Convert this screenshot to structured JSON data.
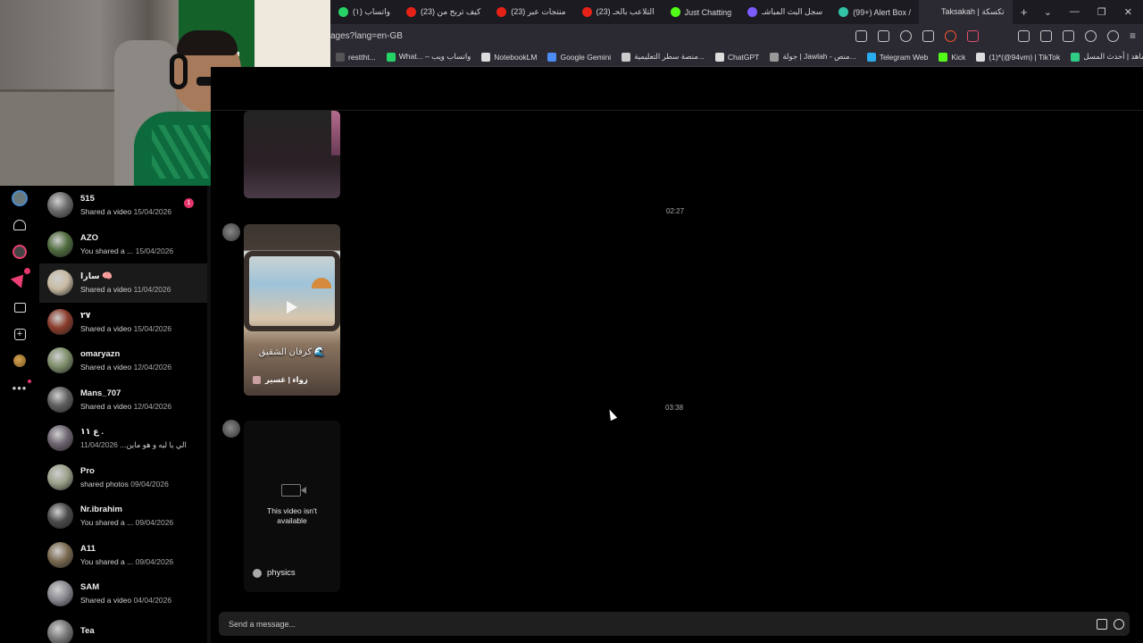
{
  "browser": {
    "tabs": [
      {
        "label": "(١) واتساب",
        "color": "#25d366"
      },
      {
        "label": "(23) كيف تربح من",
        "color": "#e62117"
      },
      {
        "label": "(23) منتجات عبر",
        "color": "#e62117"
      },
      {
        "label": "(23) التلاعب بالحـ",
        "color": "#e62117"
      },
      {
        "label": "Just Chatting",
        "color": "#53fc18"
      },
      {
        "label": "سجل البث المباشـ",
        "color": "#7b5cff"
      },
      {
        "label": "(99+) Alert Box /",
        "color": "#32c3a6"
      },
      {
        "label": "Taksakah | تكسكة",
        "color": "#2b2a33"
      }
    ],
    "url": "ages?lang=en-GB",
    "bookmarks": [
      {
        "label": "resttht...",
        "color": "#555"
      },
      {
        "label": "What... – واتساب ويب",
        "color": "#25d366"
      },
      {
        "label": "NotebookLM",
        "color": "#dddddd"
      },
      {
        "label": "Google Gemini",
        "color": "#4e8cf5"
      },
      {
        "label": "منصة سطر التعليمية...",
        "color": "#cccccc"
      },
      {
        "label": "ChatGPT",
        "color": "#dddddd"
      },
      {
        "label": "جولة | Jawlah - منص...",
        "color": "#999999"
      },
      {
        "label": "Telegram Web",
        "color": "#2aabee"
      },
      {
        "label": "Kick",
        "color": "#53fc18"
      },
      {
        "label": "(1)*(@94vm) | TikTok",
        "color": "#dddddd"
      },
      {
        "label": "شاهد | أحدث المسل...",
        "color": "#2fcc85"
      }
    ]
  },
  "conversations": [
    {
      "name": "515",
      "sub": "Shared a video",
      "date": "15/04/2026",
      "unread": "1",
      "avatar": "#6a6a6a"
    },
    {
      "name": "AZO",
      "sub": "You shared a ...",
      "date": "15/04/2026",
      "avatar": "#4f6b3e"
    },
    {
      "name": "سارا 🧠",
      "sub": "Shared a video",
      "date": "11/04/2026",
      "avatar": "#c9bba3",
      "highlight": true
    },
    {
      "name": "٢٧",
      "sub": "Shared a video",
      "date": "15/04/2026",
      "avatar": "#8a3b2a"
    },
    {
      "name": "omaryazn",
      "sub": "Shared a video",
      "date": "12/04/2026",
      "avatar": "#7e8e6a"
    },
    {
      "name": "Mans_707",
      "sub": "Shared a video",
      "date": "12/04/2026",
      "avatar": "#5f5f5f"
    },
    {
      "name": "ع ١١ .",
      "sub": "الي يا ليه و هو ماين...",
      "date": "11/04/2026",
      "avatar": "#6d6570"
    },
    {
      "name": "Pro",
      "sub": "shared photos",
      "date": "09/04/2026",
      "avatar": "#9aa08a"
    },
    {
      "name": "Nr.ibrahim",
      "sub": "You shared a ...",
      "date": "09/04/2026",
      "avatar": "#4a4a4a"
    },
    {
      "name": "A11",
      "sub": "You shared a ...",
      "date": "09/04/2026",
      "avatar": "#7a6a50"
    },
    {
      "name": "SAM",
      "sub": "Shared a video",
      "date": "04/04/2026",
      "avatar": "#8a8a92"
    },
    {
      "name": "Tea",
      "sub": "",
      "date": "",
      "avatar": "#777777"
    }
  ],
  "chat": {
    "timestamps": [
      "02:27",
      "03:38"
    ],
    "card2": {
      "caption": "كرفان الشقيق 🌊",
      "credit": "زواء | غسير"
    },
    "card3": {
      "unavailable": "This video isn't available",
      "footer": "physics"
    },
    "composer_placeholder": "Send a message..."
  }
}
